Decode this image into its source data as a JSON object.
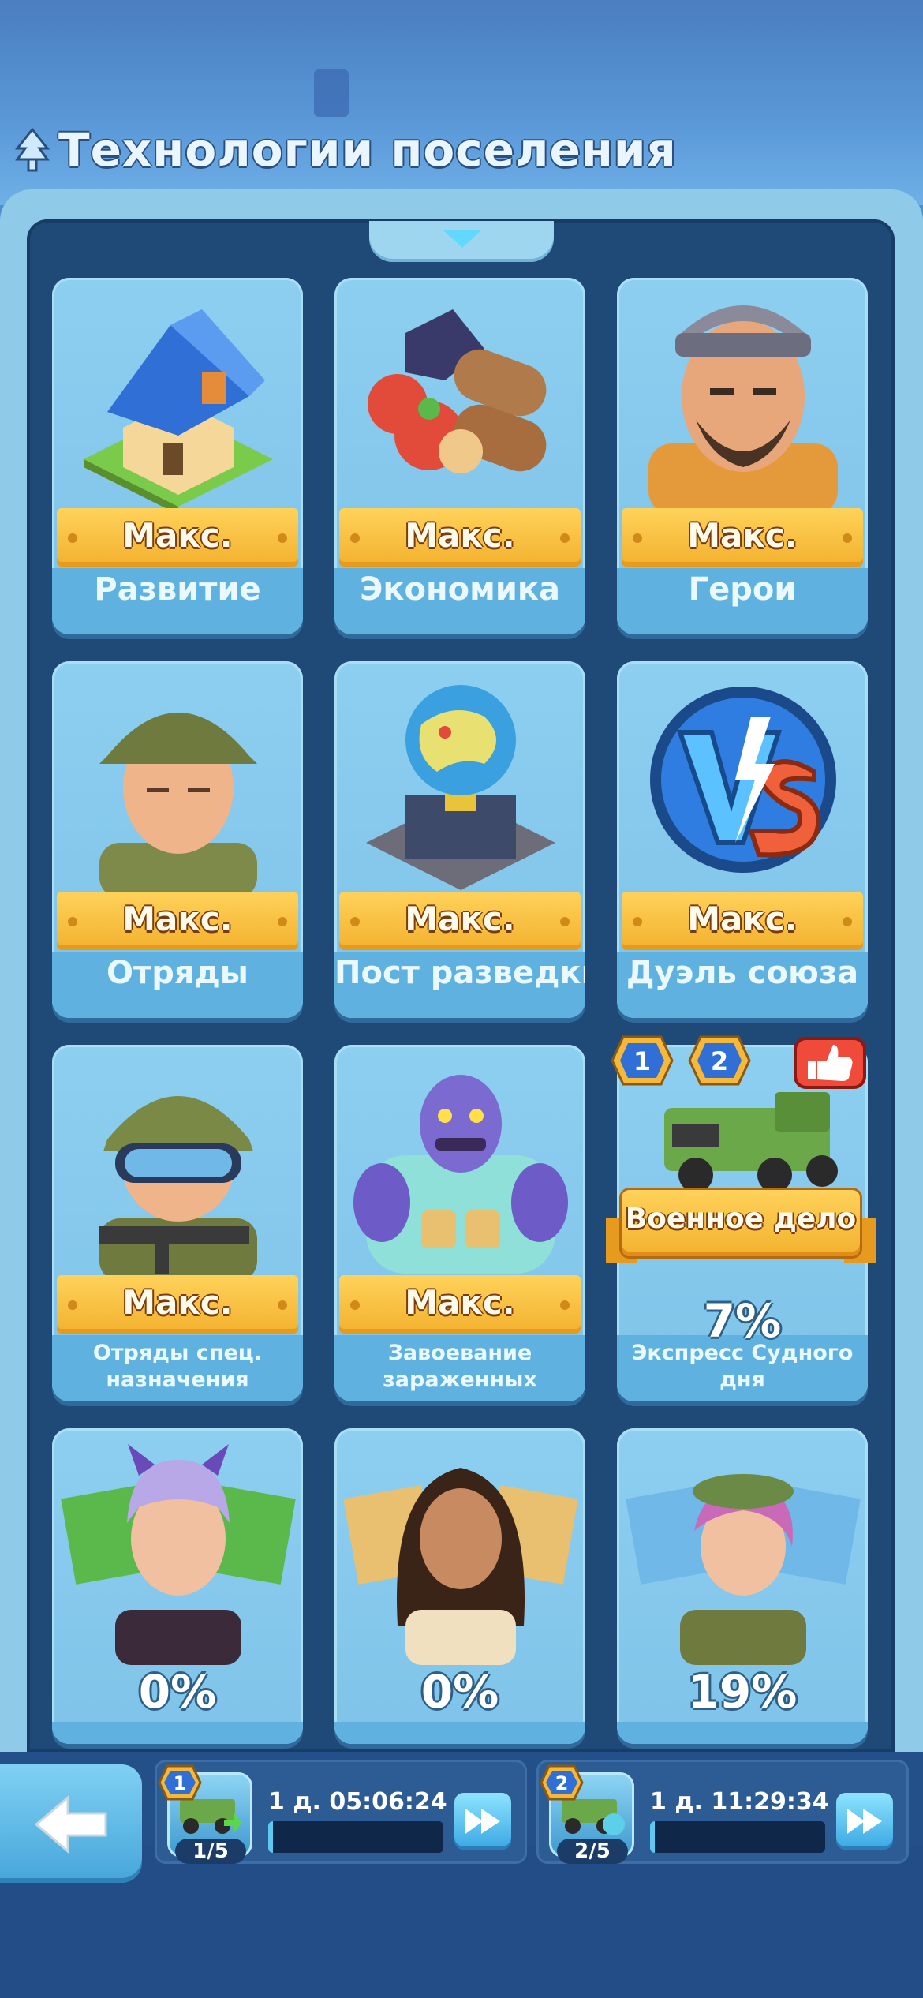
{
  "header": {
    "title": "Технологии поселения"
  },
  "cards": [
    {
      "id": "development",
      "status": "Макс.",
      "title": "Развитие"
    },
    {
      "id": "economy",
      "status": "Макс.",
      "title": "Экономика"
    },
    {
      "id": "heroes",
      "status": "Макс.",
      "title": "Герои"
    },
    {
      "id": "squads",
      "status": "Макс.",
      "title": "Отряды"
    },
    {
      "id": "recon-post",
      "status": "Макс.",
      "title": "Пост разведки"
    },
    {
      "id": "alliance-duel",
      "status": "Макс.",
      "title": "Дуэль союза"
    },
    {
      "id": "special-forces",
      "status": "Макс.",
      "title": "Отряды спец. назначения"
    },
    {
      "id": "infected-conquest",
      "status": "Макс.",
      "title": "Завоевание зараженных"
    },
    {
      "id": "doomsday-express",
      "progress": "7%",
      "title": "Экспресс Судного дня",
      "badges": [
        "1",
        "2"
      ],
      "banner": "Военное дело"
    },
    {
      "id": "tech-10",
      "progress": "0%",
      "title": ""
    },
    {
      "id": "tech-11",
      "progress": "0%",
      "title": ""
    },
    {
      "id": "tech-12",
      "progress": "19%",
      "title": ""
    }
  ],
  "research_queue": [
    {
      "slot": "1",
      "timer": "1 д. 05:06:24",
      "count": "1/5"
    },
    {
      "slot": "2",
      "timer": "1 д. 11:29:34",
      "count": "2/5"
    }
  ],
  "icons": {
    "back": "back-arrow-icon",
    "speedup": "fast-forward-icon",
    "recommend": "thumbs-up-icon"
  },
  "colors": {
    "max_banner": "#f3b12e",
    "panel": "#1f4a78",
    "card": "#8dcff0"
  }
}
